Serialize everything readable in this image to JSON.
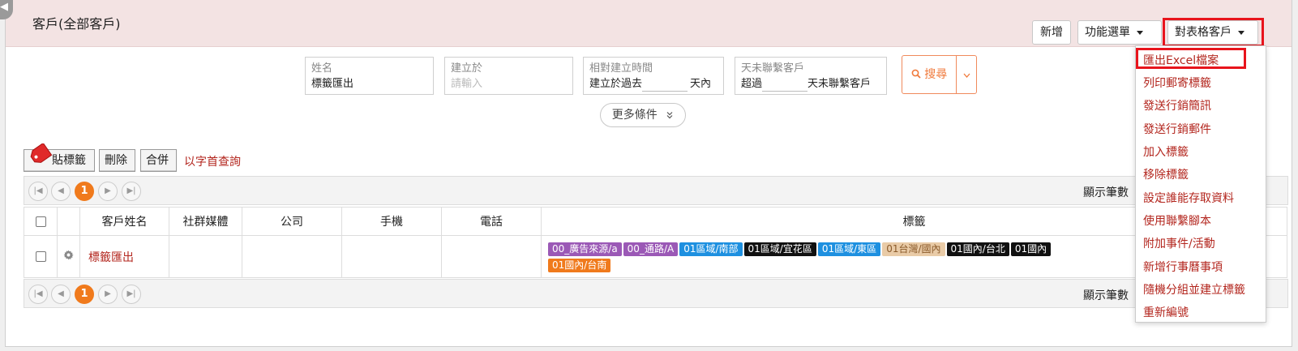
{
  "header": {
    "title": "客戶(全部客戶)",
    "add_label": "新增",
    "function_menu_label": "功能選單",
    "table_customer_label": "對表格客戶"
  },
  "filters": {
    "name": {
      "label": "姓名",
      "value": "標籤匯出"
    },
    "created": {
      "label": "建立於",
      "placeholder": "請輸入"
    },
    "relative": {
      "label": "相對建立時間",
      "prefix": "建立於過去",
      "suffix": "天內"
    },
    "no_contact": {
      "label": "天未聯繫客戶",
      "prefix": "超過",
      "suffix": "天未聯繫客戶"
    },
    "search_label": "搜尋",
    "more_label": "更多條件"
  },
  "toolbar": {
    "tag_label": "貼標籤",
    "delete_label": "刪除",
    "merge_label": "合併",
    "alpha_link": "以字首查詢"
  },
  "pager": {
    "current_page": "1",
    "page_size_label": "顯示筆數"
  },
  "table": {
    "columns": [
      "客戶姓名",
      "社群媒體",
      "公司",
      "手機",
      "電話",
      "標籤"
    ],
    "rows": [
      {
        "name": "標籤匯出",
        "social": "",
        "company": "",
        "mobile": "",
        "phone": "",
        "tags": [
          {
            "text": "00_廣告來源/a",
            "color": "#9b59b6"
          },
          {
            "text": "00_通路/A",
            "color": "#9b59b6"
          },
          {
            "text": "01區域/南部",
            "color": "#1e90e0"
          },
          {
            "text": "01區域/宜花區",
            "color": "#111111"
          },
          {
            "text": "01區域/東區",
            "color": "#1e90e0"
          },
          {
            "text": "01台灣/國內",
            "color": "#e9cba7"
          },
          {
            "text": "01國內/台北",
            "color": "#111111"
          },
          {
            "text": "01國內",
            "color": "#111111"
          },
          {
            "text": "01國內/台南",
            "color": "#f07a1c"
          }
        ]
      }
    ]
  },
  "dropdown": {
    "items": [
      "匯出Excel檔案",
      "列印郵寄標籤",
      "發送行銷簡訊",
      "發送行銷郵件",
      "加入標籤",
      "移除標籤",
      "設定誰能存取資料",
      "使用聯繫腳本",
      "附加事件/活動",
      "新增行事曆事項",
      "隨機分組並建立標籤",
      "重新編號"
    ]
  },
  "colors": {
    "accent_red": "#b3261e",
    "search_orange": "#f07a3c",
    "active_page": "#f07a1c",
    "highlight_box": "#e8141c",
    "header_bg": "#f3e3e3"
  },
  "icons": [
    "collapse-icon",
    "caret-down-icon",
    "search-icon",
    "double-chevron-down-icon",
    "tag-icon",
    "first-page-icon",
    "prev-page-icon",
    "next-page-icon",
    "last-page-icon",
    "gear-icon",
    "checkbox-icon"
  ]
}
